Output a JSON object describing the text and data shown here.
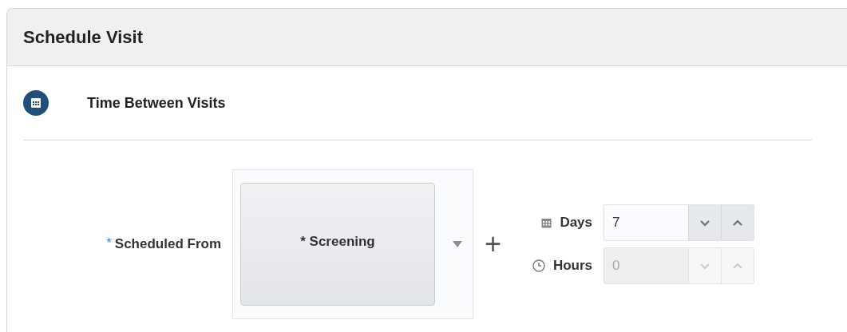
{
  "window": {
    "title": "Schedule Visit"
  },
  "section": {
    "title": "Time Between Visits"
  },
  "scheduled_from": {
    "required_mark": "*",
    "label": "Scheduled From",
    "value": "* Screening"
  },
  "plus": "+",
  "durations": [
    {
      "kind": "calendar",
      "label": "Days",
      "value": "7",
      "disabled": false
    },
    {
      "kind": "clock",
      "label": "Hours",
      "value": "0",
      "disabled": true
    }
  ]
}
